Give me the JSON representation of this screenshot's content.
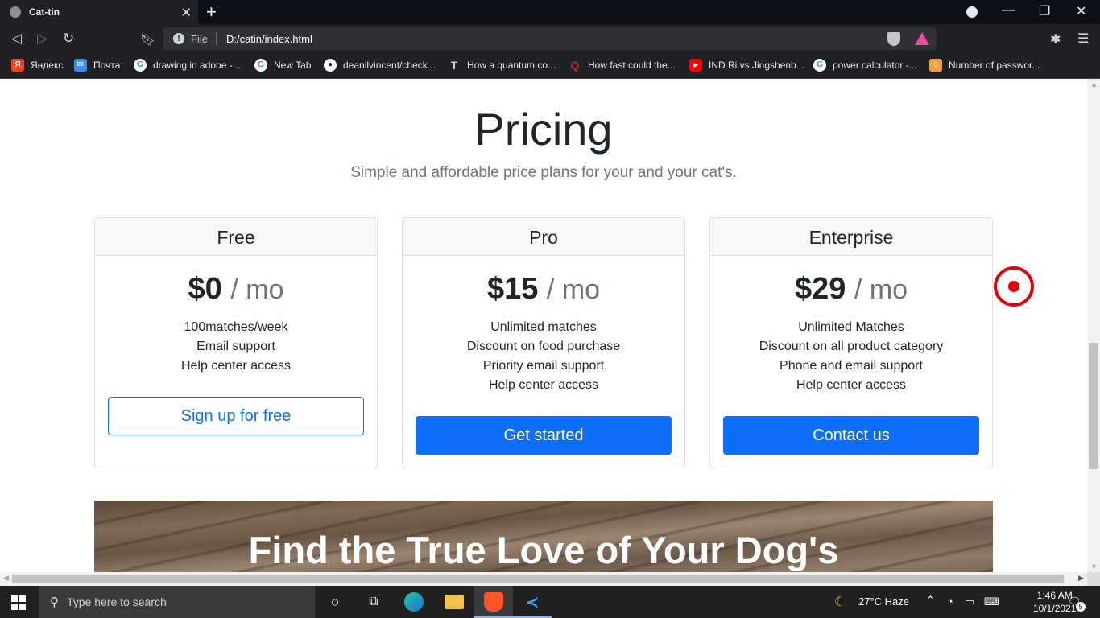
{
  "browser": {
    "tab_title": "Cat-tin",
    "tab_close": "✕",
    "new_tab": "+",
    "url_label": "File",
    "url": "D:/catin/index.html",
    "window_controls": {
      "minimize": "—",
      "restore": "❐",
      "close": "✕"
    },
    "bookmarks": [
      {
        "label": "Яндекс",
        "icon": "yandex-icon",
        "color": "#fc3f1d"
      },
      {
        "label": "Почта",
        "icon": "mail-icon",
        "color": "#3e8be9"
      },
      {
        "label": "drawing in adobe -...",
        "icon": "google-icon",
        "color": "#4285f4"
      },
      {
        "label": "New Tab",
        "icon": "google-icon",
        "color": "#4285f4"
      },
      {
        "label": "deanilvincent/check...",
        "icon": "github-icon",
        "color": "#ffffff"
      },
      {
        "label": "How a quantum co...",
        "icon": "t-icon",
        "color": "#cfcfcf"
      },
      {
        "label": "How fast could the...",
        "icon": "quora-icon",
        "color": "#b92b27"
      },
      {
        "label": "IND Ri vs Jingshenb...",
        "icon": "youtube-icon",
        "color": "#ff0000"
      },
      {
        "label": "power calculator -...",
        "icon": "google-icon",
        "color": "#4285f4"
      },
      {
        "label": "Number of passwor...",
        "icon": "app-icon",
        "color": "#f0a040"
      }
    ]
  },
  "page": {
    "heading": "Pricing",
    "subheading": "Simple and affordable price plans for your and your cat's.",
    "plans": [
      {
        "name": "Free",
        "price": "$0",
        "period": "/ mo",
        "features": [
          "100matches/week",
          "Email support",
          "Help center access"
        ],
        "button": "Sign up for free",
        "button_style": "outline"
      },
      {
        "name": "Pro",
        "price": "$15",
        "period": "/ mo",
        "features": [
          "Unlimited matches",
          "Discount on food purchase",
          "Priority email support",
          "Help center access"
        ],
        "button": "Get started",
        "button_style": "primary"
      },
      {
        "name": "Enterprise",
        "price": "$29",
        "period": "/ mo",
        "features": [
          "Unlimited Matches",
          "Discount on all product category",
          "Phone and email support",
          "Help center access"
        ],
        "button": "Contact us",
        "button_style": "primary"
      }
    ],
    "banner_title": "Find the True Love of Your Dog's"
  },
  "taskbar": {
    "search_placeholder": "Type here to search",
    "weather": "27°C  Haze",
    "time": "1:46 AM",
    "date": "10/1/2021",
    "notifications": "5"
  },
  "colors": {
    "primary": "#0d6efd",
    "cursor": "#e5000a"
  }
}
